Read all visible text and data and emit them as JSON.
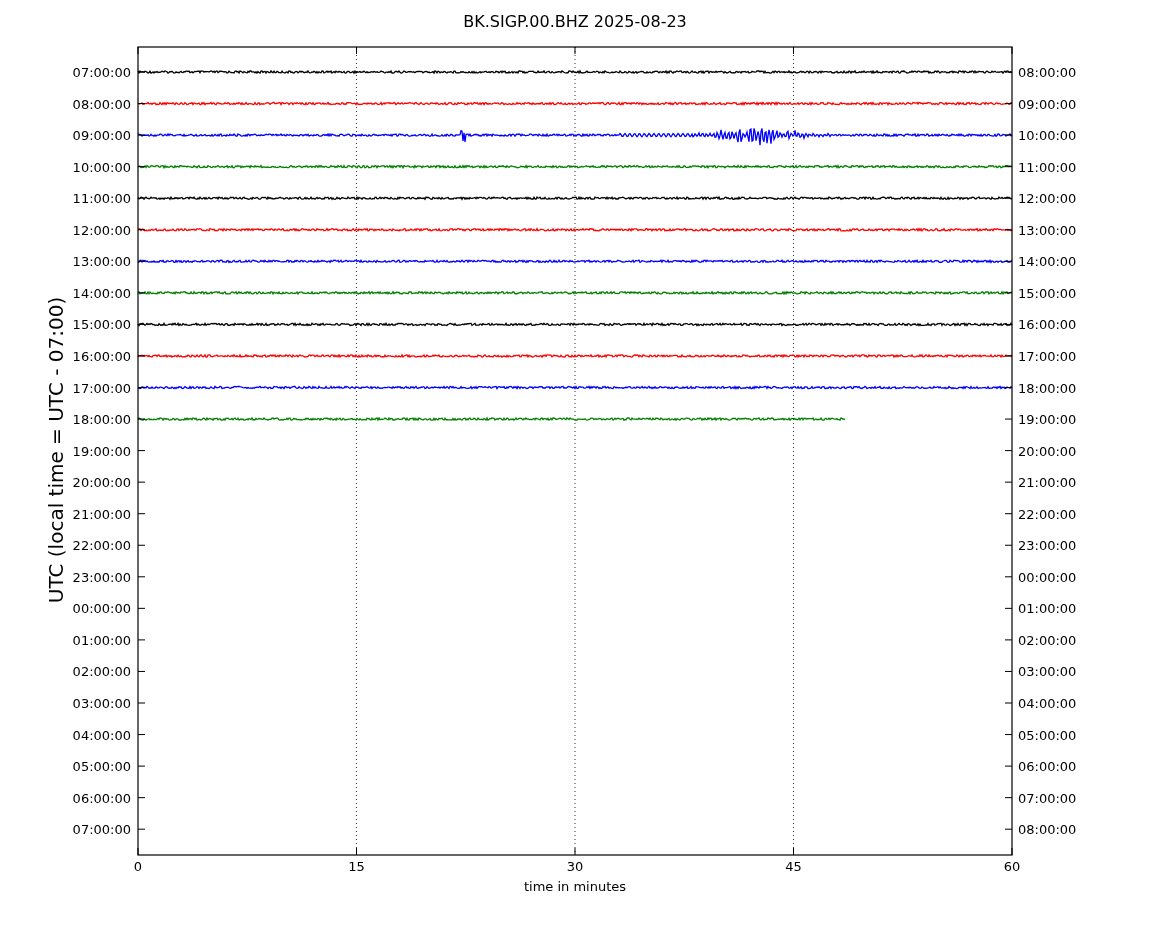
{
  "plot": {
    "title": "BK.SIGP.00.BHZ 2025-08-23",
    "xlabel": "time in minutes",
    "ylabel": "UTC (local time = UTC - 07:00)",
    "xticks": [
      "0",
      "15",
      "30",
      "45",
      "60"
    ],
    "yticks": [
      "07:00:00",
      "08:00:00",
      "09:00:00",
      "10:00:00",
      "11:00:00",
      "12:00:00",
      "13:00:00",
      "14:00:00",
      "15:00:00",
      "16:00:00",
      "17:00:00",
      "18:00:00",
      "19:00:00",
      "20:00:00",
      "21:00:00",
      "22:00:00",
      "23:00:00",
      "00:00:00",
      "01:00:00",
      "02:00:00",
      "03:00:00",
      "04:00:00",
      "05:00:00",
      "06:00:00",
      "07:00:00"
    ]
  },
  "right_axis": {
    "labels": [
      "08:00:00",
      "09:00:00",
      "10:00:00",
      "11:00:00",
      "12:00:00",
      "13:00:00",
      "14:00:00",
      "15:00:00",
      "16:00:00",
      "17:00:00",
      "18:00:00",
      "19:00:00",
      "20:00:00",
      "21:00:00",
      "22:00:00",
      "23:00:00",
      "00:00:00",
      "01:00:00",
      "02:00:00",
      "03:00:00",
      "04:00:00",
      "05:00:00",
      "06:00:00",
      "07:00:00",
      "08:00:00"
    ]
  },
  "traces": [
    {
      "kind": "noise",
      "color": "#000000",
      "level": 1
    },
    {
      "kind": "noise",
      "color": "#ff0000",
      "level": 1
    },
    {
      "kind": "event",
      "color": "#0000ff",
      "level": 1
    },
    {
      "kind": "noise",
      "color": "#008000",
      "level": 1
    },
    {
      "kind": "noise",
      "color": "#000000",
      "level": 1
    },
    {
      "kind": "noise",
      "color": "#ff0000",
      "level": 1
    },
    {
      "kind": "noise",
      "color": "#0000ff",
      "level": 1
    },
    {
      "kind": "noise",
      "color": "#008000",
      "level": 1
    },
    {
      "kind": "noise",
      "color": "#000000",
      "level": 1
    },
    {
      "kind": "noise",
      "color": "#ff0000",
      "level": 1
    },
    {
      "kind": "noise",
      "color": "#0000ff",
      "level": 1
    },
    {
      "kind": "noise",
      "color": "#008000",
      "level": 0.81
    }
  ]
}
